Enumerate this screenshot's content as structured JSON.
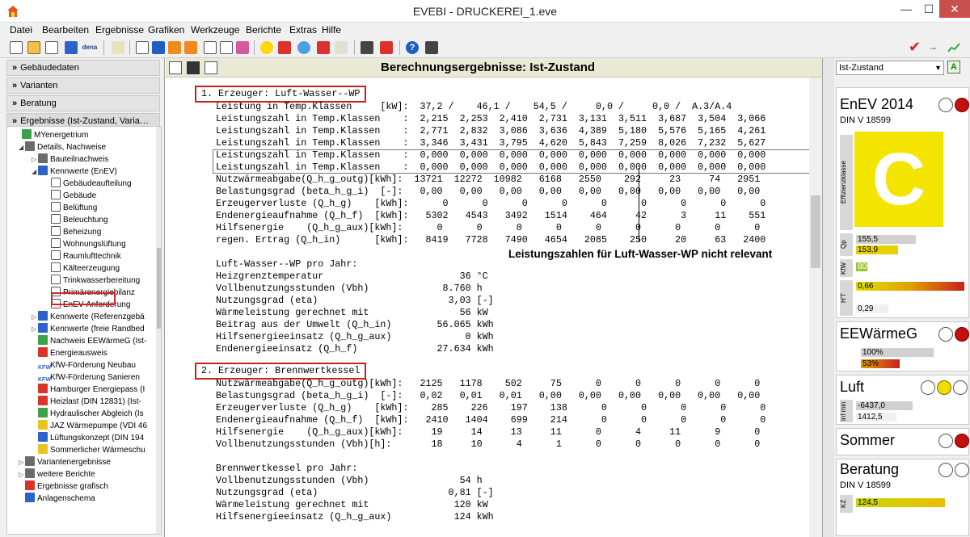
{
  "window": {
    "title": "EVEBI - DRUCKEREI_1.eve",
    "minimize": "—",
    "maximize": "☐",
    "close": "✕"
  },
  "menu": [
    "Datei",
    "Bearbeiten",
    "Ergebnisse",
    "Grafiken",
    "Werkzeuge",
    "Berichte",
    "Extras",
    "Hilfe"
  ],
  "toolbar": {
    "dena_label": "dena"
  },
  "left": {
    "sections": [
      "Gebäudedaten",
      "Varianten",
      "Beratung",
      "Ergebnisse (Ist-Zustand, Varia…"
    ],
    "tree": [
      "MYenergetrium",
      "Details, Nachweise",
      "Bauteilnachweis",
      "Kennwerte (EnEV)",
      "Gebäudeaufteilung",
      "Gebäude",
      "Belüftung",
      "Beleuchtung",
      "Beheizung",
      "Wohnungslüftung",
      "Raumlufttechnik",
      "Kälteerzeugung",
      "Trinkwasserbereitung",
      "Primärenergiebilanz",
      "EnEV-Anforderung",
      "Kennwerte (Referenzgebä",
      "Kennwerte (freie Randbed",
      "Nachweis EEWärmeG (Ist-",
      "Energieausweis",
      "KfW-Förderung Neubau",
      "KfW-Förderung Sanieren",
      "Hamburger Energiepass (I",
      "Heizlast (DIN 12831) (Ist-",
      "Hydraulischer Abgleich (Is",
      "JAZ Wärmepumpe (VDI 46",
      "Lüftungskonzept (DIN 194",
      "Sommerlicher Wärmeschu",
      "Variantenergebnisse",
      "weitere Berichte",
      "Ergebnisse grafisch",
      "Anlagenschema"
    ],
    "kfw_label": "KFW"
  },
  "main": {
    "title": "Berechnungsergebnisse: Ist-Zustand",
    "note": "Leistungszahlen für Luft-Wasser-WP nicht relevant",
    "lines": [
      "1. Erzeuger: Luft-Wasser--WP",
      "Leistung in Temp.Klassen     [kW]:  37,2 /    46,1 /    54,5 /     0,0 /     0,0 /  A.3/A.4",
      "Leistungszahl in Temp.Klassen    :  2,215  2,253  2,410  2,731  3,131  3,511  3,687  3,504  3,066",
      "Leistungszahl in Temp.Klassen    :  2,771  2,832  3,086  3,636  4,389  5,180  5,576  5,165  4,261",
      "Leistungszahl in Temp.Klassen    :  3,346  3,431  3,795  4,620  5,843  7,259  8,026  7,232  5,627",
      "Leistungszahl in Temp.Klassen    :  0,000  0,000  0,000  0,000  0,000  0,000  0,000  0,000  0,000",
      "Leistungszahl in Temp.Klassen    :  0,000  0,000  0,000  0,000  0,000  0,000  0,000  0,000  0,000",
      "Nutzwärmeabgabe(Q_h_g_outg)[kWh]:  13721  12272  10982   6168   2550    292     23     74   2951",
      "Belastungsgrad (beta_h_g_i)  [-]:   0,00   0,00   0,00   0,00   0,00   0,00   0,00   0,00   0,00",
      "Erzeugerverluste (Q_h_g)    [kWh]:      0      0      0      0      0      0      0      0      0",
      "Endenergieaufnahme (Q_h_f)  [kWh]:   5302   4543   3492   1514    464     42      3     11    551",
      "Hilfsenergie    (Q_h_g_aux)[kWh]:      0      0      0      0      0      0      0      0      0",
      "regen. Ertrag (Q_h_in)      [kWh]:   8419   7728   7490   4654   2085    250     20     63   2400",
      "Luft-Wasser--WP pro Jahr:",
      "Heizgrenztemperatur                        36 °C",
      "Vollbenutzungsstunden (Vbh)             8.760 h",
      "Nutzungsgrad (eta)                       3,03 [-]",
      "Wärmeleistung gerechnet mit                56 kW",
      "Beitrag aus der Umwelt (Q_h_in)        56.065 kWh",
      "Hilfsenergieeinsatz (Q_h_g_aux)             0 kWh",
      "Endenergieeinsatz (Q_h_f)              27.634 kWh",
      "2. Erzeuger: Brennwertkessel",
      "Nutzwärmeabgabe(Q_h_g_outg)[kWh]:   2125   1178    502     75      0      0      0      0      0",
      "Belastungsgrad (beta_h_g_i)  [-]:   0,02   0,01   0,01   0,00   0,00   0,00   0,00   0,00   0,00",
      "Erzeugerverluste (Q_h_g)    [kWh]:    285    226    197    138      0      0      0      0      0",
      "Endenergieaufnahme (Q_h_f)  [kWh]:   2410   1404    699    214      0      0      0      0      0",
      "Hilfsenergie    (Q_h_g_aux)[kWh]:     19     14     13     11      0      4     11      9      0",
      "Vollbenutzungsstunden (Vbh)[h]:       18     10      4      1      0      0      0      0      0",
      "Brennwertkessel pro Jahr:",
      "Vollbenutzungsstunden (Vbh)                54 h",
      "Nutzungsgrad (eta)                       0,81 [-]",
      "Wärmeleistung gerechnet mit               120 kW",
      "Hilfsenergieeinsatz (Q_h_g_aux)           124 kWh"
    ]
  },
  "right": {
    "state": "Ist-Zustand",
    "a_label": "A",
    "enev": {
      "title": "EnEV 2014",
      "sub": "DIN V 18599",
      "vlabel": "Effizienzklasse",
      "class_letter": "C",
      "qp_label": "Qp",
      "qp_values": [
        "155,5",
        "153,9"
      ],
      "kw_label": "KfW",
      "kw_value": "80",
      "ht_label": "H'T",
      "ht_values": [
        "0,66",
        "0,29"
      ]
    },
    "eewg": {
      "title": "EEWärmeG",
      "bar1": "100%",
      "bar2": "53%"
    },
    "luft": {
      "title": "Luft",
      "vlabel": "inf min",
      "v1": "-6437,0",
      "v2": "1412,5"
    },
    "sommer": {
      "title": "Sommer"
    },
    "beratung": {
      "title": "Beratung",
      "sub": "DIN V 18599",
      "kz_label": "KZ",
      "kz_value": "124,5"
    },
    "colors": {
      "effclass": "#f3e500",
      "red": "#c40f0f",
      "yellow": "#f0dc00",
      "bar_green": "#9cc43a"
    }
  }
}
